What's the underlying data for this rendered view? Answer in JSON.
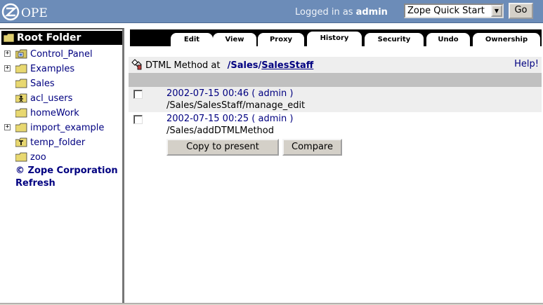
{
  "header": {
    "logo_text": "ZOPE",
    "logged_in_label": "Logged in as",
    "username": "admin",
    "quick_start_selected": "Zope Quick Start",
    "go_label": "Go"
  },
  "tree": {
    "root_label": "Root Folder",
    "items": [
      {
        "label": "Control_Panel",
        "expandable": true,
        "icon": "control-panel-icon"
      },
      {
        "label": "Examples",
        "expandable": true,
        "icon": "folder-icon"
      },
      {
        "label": "Sales",
        "expandable": false,
        "icon": "folder-icon"
      },
      {
        "label": "acl_users",
        "expandable": false,
        "icon": "user-folder-icon"
      },
      {
        "label": "homeWork",
        "expandable": false,
        "icon": "folder-icon"
      },
      {
        "label": "import_example",
        "expandable": true,
        "icon": "folder-icon"
      },
      {
        "label": "temp_folder",
        "expandable": false,
        "icon": "temp-folder-icon"
      },
      {
        "label": "zoo",
        "expandable": false,
        "icon": "folder-icon"
      }
    ],
    "copyright": "© Zope Corporation",
    "refresh": "Refresh"
  },
  "tabs": [
    {
      "label": "Edit",
      "active": false
    },
    {
      "label": "View",
      "active": false
    },
    {
      "label": "Proxy",
      "active": false
    },
    {
      "label": "History",
      "active": true
    },
    {
      "label": "Security",
      "active": false
    },
    {
      "label": "Undo",
      "active": false
    },
    {
      "label": "Ownership",
      "active": false
    }
  ],
  "content": {
    "object_type": "DTML Method at",
    "path_part1": "/Sales",
    "path_sep": "/",
    "path_part2": "SalesStaff",
    "help": "Help!",
    "history": [
      {
        "link": "2002-07-15 00:46 ( admin )",
        "path": "/Sales/SalesStaff/manage_edit"
      },
      {
        "link": "2002-07-15 00:25 ( admin )",
        "path": "/Sales/addDTMLMethod"
      }
    ],
    "copy_button": "Copy to present",
    "compare_button": "Compare"
  },
  "colors": {
    "topbar": "#6c8cb8",
    "link": "#000080",
    "row_alt": "#eeeeee",
    "header_bar": "#c0c0c0"
  }
}
